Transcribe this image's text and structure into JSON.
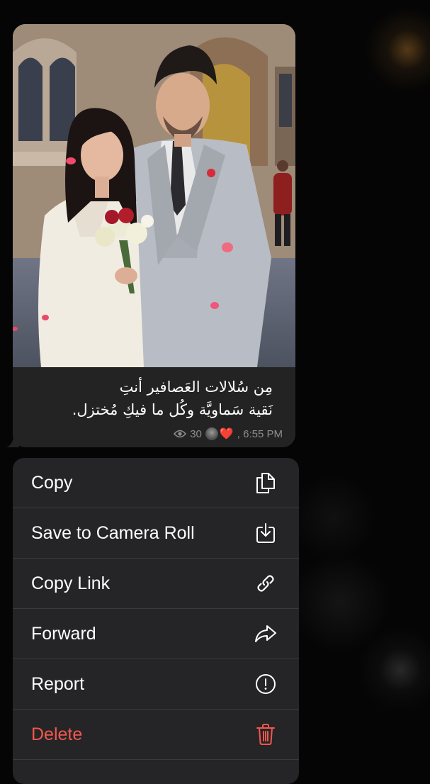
{
  "message": {
    "caption_lines": [
      "مِن سُلالات العَصافير أنتِ",
      "نَقية سَماويَّة وكُل ما فيكِ مُختزل."
    ],
    "views": "30",
    "reaction_emoji": "❤️",
    "time": ", 6:55 PM"
  },
  "context_menu": {
    "items": [
      {
        "label": "Copy",
        "icon": "copy-icon"
      },
      {
        "label": "Save to Camera Roll",
        "icon": "save-download-icon"
      },
      {
        "label": "Copy Link",
        "icon": "link-icon"
      },
      {
        "label": "Forward",
        "icon": "forward-arrow-icon"
      },
      {
        "label": "Report",
        "icon": "exclamation-circle-icon"
      },
      {
        "label": "Delete",
        "icon": "trash-icon"
      }
    ],
    "colors": {
      "text": "#ffffff",
      "danger": "#f2574d",
      "background": "#252527"
    }
  }
}
